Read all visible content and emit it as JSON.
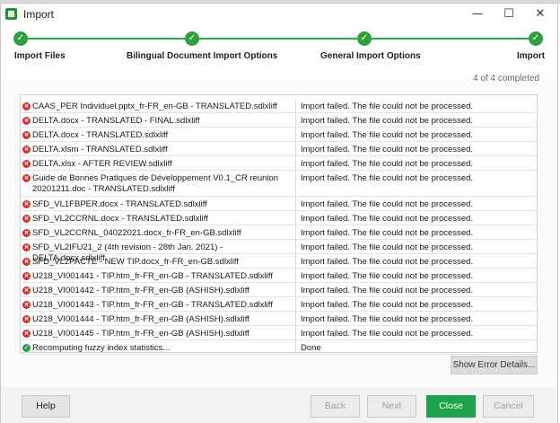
{
  "window": {
    "title": "Import"
  },
  "window_controls": {
    "minimize": "—",
    "maximize": "☐",
    "close": "✕"
  },
  "wizard": {
    "steps": [
      {
        "label": "Import Files"
      },
      {
        "label": "Bilingual Document Import Options"
      },
      {
        "label": "General Import Options"
      },
      {
        "label": "Import"
      }
    ],
    "progress_text": "4 of 4 completed"
  },
  "results": [
    {
      "file": "CAAS_PER  Individuel.pptx_fr-FR_en-GB  - TRANSLATED.sdlxliff",
      "status": "Import failed. The file could not be processed.",
      "state": "error"
    },
    {
      "file": "DELTA.docx - TRANSLATED - FINAL.sdlxliff",
      "status": "Import failed. The file could not be processed.",
      "state": "error"
    },
    {
      "file": "DELTA.docx - TRANSLATED.sdlxliff",
      "status": "Import failed. The file could not be processed.",
      "state": "error"
    },
    {
      "file": "DELTA.xlsm - TRANSLATED.sdlxliff",
      "status": "Import failed. The file could not be processed.",
      "state": "error"
    },
    {
      "file": "DELTA.xlsx - AFTER REVIEW.sdlxliff",
      "status": "Import failed. The file could not be processed.",
      "state": "error"
    },
    {
      "file": "Guide de Bonnes Pratiques de Développement V0.1_CR reunion 20201211.doc - TRANSLATED.sdlxliff",
      "status": "Import failed. The file could not be processed.",
      "state": "error"
    },
    {
      "file": "SFD_VL1FBPER.docx - TRANSLATED.sdlxliff",
      "status": "Import failed. The file could not be processed.",
      "state": "error"
    },
    {
      "file": "SFD_VL2CCRNL.docx - TRANSLATED.sdlxliff",
      "status": "Import failed. The file could not be processed.",
      "state": "error"
    },
    {
      "file": "SFD_VL2CCRNL_04022021.docx_fr-FR_en-GB.sdlxliff",
      "status": "Import failed. The file could not be processed.",
      "state": "error"
    },
    {
      "file": "SFD_VL2IFU21_2 (4th revision - 28th Jan. 2021) - DELTA.docx.sdlxliff",
      "status": "Import failed. The file could not be processed.",
      "state": "error"
    },
    {
      "file": "SFD_VL2PACTE - NEW TIP.docx_fr-FR_en-GB.sdlxliff",
      "status": "Import failed. The file could not be processed.",
      "state": "error"
    },
    {
      "file": "U218_VI001441 - TIP.htm_fr-FR_en-GB - TRANSLATED.sdlxliff",
      "status": "Import failed. The file could not be processed.",
      "state": "error"
    },
    {
      "file": "U218_VI001442 - TIP.htm_fr-FR_en-GB (ASHISH).sdlxliff",
      "status": "Import failed. The file could not be processed.",
      "state": "error"
    },
    {
      "file": "U218_VI001443 - TIP.htm_fr-FR_en-GB - TRANSLATED.sdlxliff",
      "status": "Import failed. The file could not be processed.",
      "state": "error"
    },
    {
      "file": "U218_VI001444 - TIP.htm_fr-FR_en-GB (ASHISH).sdlxliff",
      "status": "Import failed. The file could not be processed.",
      "state": "error"
    },
    {
      "file": "U218_VI001445 - TIP.htm_fr-FR_en-GB (ASHISH).sdlxliff",
      "status": "Import failed. The file could not be processed.",
      "state": "error"
    },
    {
      "file": "Recomputing fuzzy index statistics...",
      "status": "Done",
      "state": "success"
    }
  ],
  "buttons": {
    "show_error_details": "Show Error Details...",
    "help": "Help",
    "back": "Back",
    "next": "Next",
    "close": "Close",
    "cancel": "Cancel"
  },
  "colors": {
    "accent_green": "#30a03f",
    "close_button": "#1fa34a",
    "error_red": "#d9342b"
  },
  "icons": {
    "step_done": "checkmark-icon",
    "row_error": "error-circle-icon",
    "row_success": "success-check-icon"
  }
}
